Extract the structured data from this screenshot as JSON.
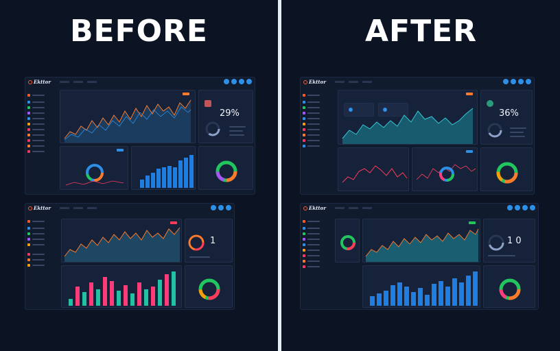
{
  "before": {
    "label": "BEFORE"
  },
  "after": {
    "label": "AFTER"
  },
  "before_top": {
    "stat": "29%"
  },
  "after_top": {
    "stat": "36%"
  },
  "before_bottom": {
    "stat": "1"
  },
  "after_bottom": {
    "stat": "1 0"
  },
  "colors": {
    "background": "#0c1424",
    "panel": "#16223a",
    "accent_blue": "#2e8fe6",
    "accent_orange": "#ff7a2a",
    "accent_green": "#22c55e",
    "accent_red": "#ff3b5c"
  }
}
